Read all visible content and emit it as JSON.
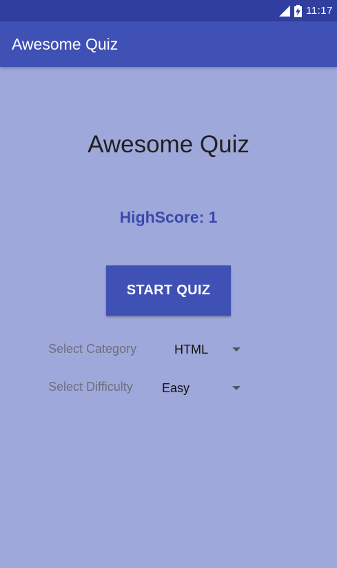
{
  "status_bar": {
    "time": "11:17"
  },
  "app_bar": {
    "title": "Awesome Quiz"
  },
  "main": {
    "title": "Awesome Quiz",
    "highscore": "HighScore: 1",
    "start_button": "START QUIZ"
  },
  "category": {
    "label": "Select Category",
    "selected": "HTML"
  },
  "difficulty": {
    "label": "Select Difficulty",
    "selected": "Easy"
  },
  "colors": {
    "background": "#9fa8da",
    "primary": "#3f51b5",
    "primary_dark": "#303f9f",
    "highscore_text": "#3949ab"
  }
}
